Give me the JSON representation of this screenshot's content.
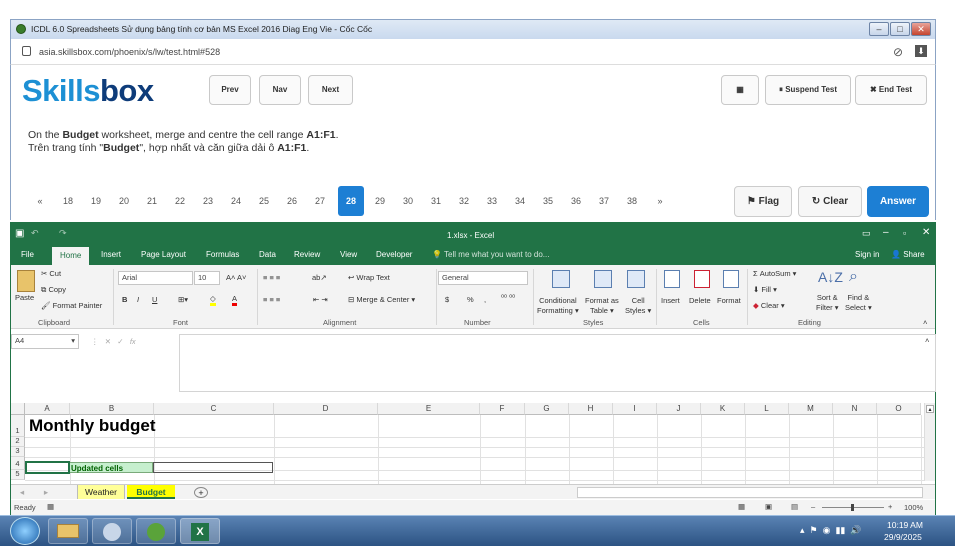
{
  "browser": {
    "window_title": "ICDL 6.0 Spreadsheets Sử dụng bảng tính cơ bản MS Excel 2016 Diag Eng Vie - Cốc Cốc",
    "url": "asia.skillsbox.com/phoenix/s/lw/test.html#528"
  },
  "skillsbox": {
    "logo_part1": "Skills",
    "logo_part2": "box",
    "prev": "Prev",
    "nav": "Nav",
    "next": "Next",
    "suspend": "Suspend Test",
    "end": "End Test",
    "question_en_1": "On the ",
    "question_en_b1": "Budget",
    "question_en_2": " worksheet, merge and centre the cell range ",
    "question_en_b2": "A1:F1",
    "question_en_3": ".",
    "question_vi_1": "Trên trang tính \"",
    "question_vi_b1": "Budget",
    "question_vi_2": "\", hợp nhất và căn giữa dải ô ",
    "question_vi_b2": "A1:F1",
    "question_vi_3": ".",
    "pages": [
      "«",
      "18",
      "19",
      "20",
      "21",
      "22",
      "23",
      "24",
      "25",
      "26",
      "27",
      "28",
      "29",
      "30",
      "31",
      "32",
      "33",
      "34",
      "35",
      "36",
      "37",
      "38",
      "»"
    ],
    "current_page": "28",
    "flag": "Flag",
    "clear": "Clear",
    "answer": "Answer"
  },
  "excel": {
    "file_title": "1.xlsx - Excel",
    "tabs": [
      "File",
      "Home",
      "Insert",
      "Page Layout",
      "Formulas",
      "Data",
      "Review",
      "View",
      "Developer"
    ],
    "tell_me": "Tell me what you want to do...",
    "sign_in": "Sign in",
    "share": "Share",
    "clipboard": {
      "paste": "Paste",
      "cut": "Cut",
      "copy": "Copy",
      "format_painter": "Format Painter",
      "label": "Clipboard"
    },
    "font": {
      "name": "Arial",
      "size": "10",
      "bold": "B",
      "italic": "I",
      "underline": "U",
      "label": "Font"
    },
    "alignment": {
      "wrap": "Wrap Text",
      "merge": "Merge & Center",
      "label": "Alignment"
    },
    "number": {
      "format": "General",
      "currency": "$",
      "percent": "%",
      "comma": ",",
      "label": "Number"
    },
    "styles": {
      "cond": "Conditional",
      "cond2": "Formatting",
      "fmt_table": "Format as",
      "fmt_table2": "Table",
      "cell_styles": "Cell",
      "cell_styles2": "Styles",
      "label": "Styles"
    },
    "cells": {
      "insert": "Insert",
      "delete": "Delete",
      "format": "Format",
      "label": "Cells"
    },
    "editing": {
      "autosum": "AutoSum",
      "fill": "Fill",
      "clear": "Clear",
      "sort": "Sort &",
      "sort2": "Filter",
      "find": "Find &",
      "find2": "Select",
      "label": "Editing"
    },
    "name_box": "A4",
    "columns": [
      "A",
      "B",
      "C",
      "D",
      "E",
      "F",
      "G",
      "H",
      "I",
      "J",
      "K",
      "L",
      "M",
      "N",
      "O"
    ],
    "rows": [
      "1",
      "2",
      "3",
      "4",
      "5"
    ],
    "a1": "Monthly budget",
    "b4": "Updated cells",
    "sheets": [
      "Weather",
      "Budget"
    ],
    "active_sheet": "Budget",
    "status": "Ready",
    "zoom": "100%"
  },
  "taskbar": {
    "time": "10:19 AM",
    "date": "29/9/2025"
  }
}
